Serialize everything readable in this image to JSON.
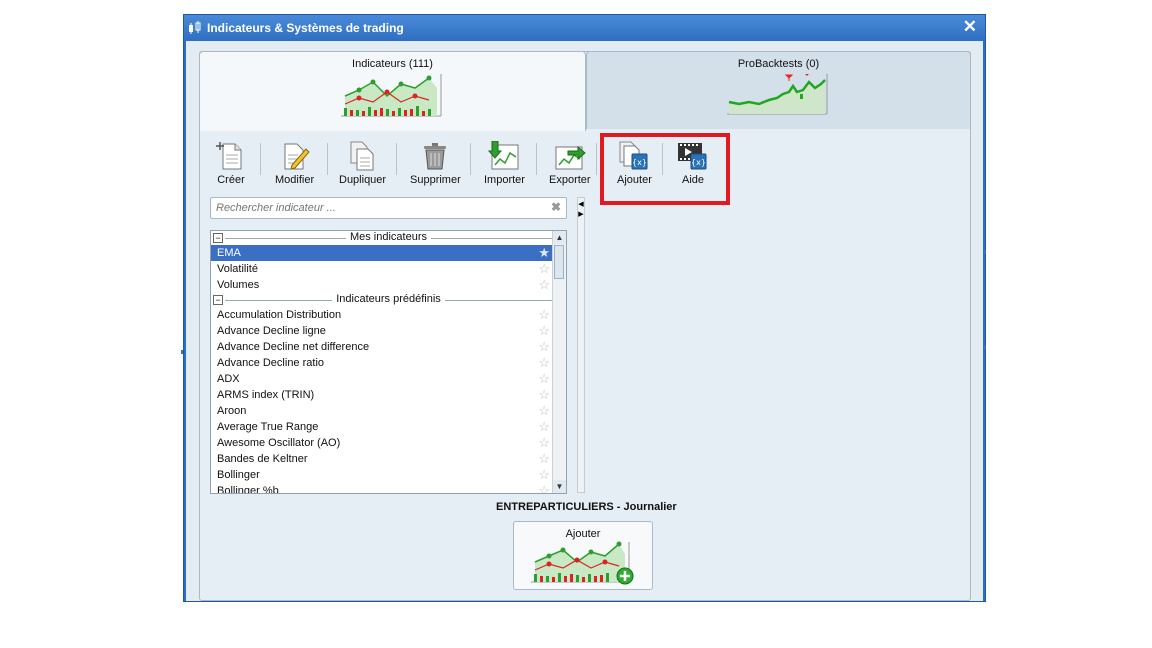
{
  "window": {
    "title": "Indicateurs & Systèmes de trading",
    "close_glyph": "✕"
  },
  "tabs": [
    {
      "label": "Indicateurs (111)",
      "active": true
    },
    {
      "label": "ProBacktests (0)",
      "active": false
    }
  ],
  "toolbar": {
    "create": "Créer",
    "modify": "Modifier",
    "duplicate": "Dupliquer",
    "delete": "Supprimer",
    "import": "Importer",
    "export": "Exporter",
    "add": "Ajouter",
    "help": "Aide"
  },
  "search": {
    "placeholder": "Rechercher indicateur ..."
  },
  "list": {
    "groups": [
      {
        "label": "Mes indicateurs",
        "items": [
          "EMA",
          "Volatilité",
          "Volumes"
        ],
        "selected": "EMA"
      },
      {
        "label": "Indicateurs prédéfinis",
        "items": [
          "Accumulation Distribution",
          "Advance Decline ligne",
          "Advance Decline net difference",
          "Advance Decline ratio",
          "ADX",
          "ARMS index (TRIN)",
          "Aroon",
          "Average True Range",
          "Awesome Oscillator (AO)",
          "Bandes de Keltner",
          "Bollinger",
          "Bollinger %b"
        ]
      }
    ]
  },
  "account_label": "ENTREPARTICULIERS - Journalier",
  "add_panel": {
    "label": "Ajouter"
  },
  "colors": {
    "accent": "#2a6fc0",
    "selection": "#3b6fc4",
    "highlight_box": "#e11a22",
    "chart_green": "#2e9e2e",
    "chart_red": "#d22"
  }
}
